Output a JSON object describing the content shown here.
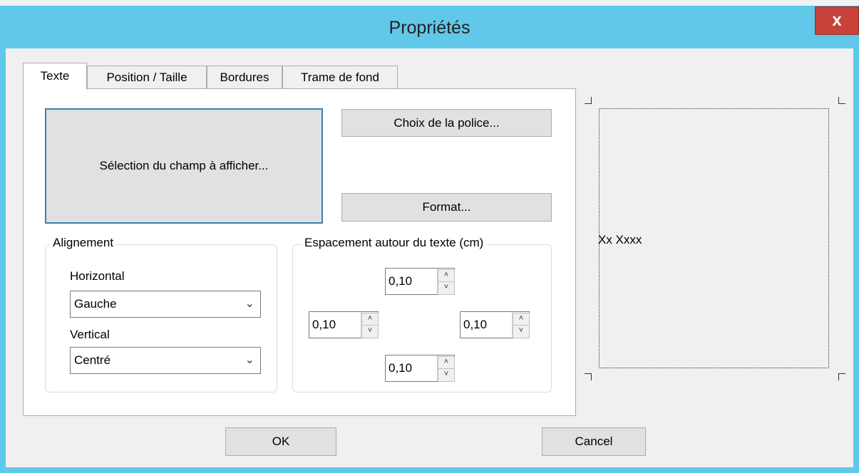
{
  "window": {
    "title": "Propriétés",
    "close_label": "x"
  },
  "tabs": [
    {
      "label": "Texte",
      "active": true
    },
    {
      "label": "Position / Taille",
      "active": false
    },
    {
      "label": "Bordures",
      "active": false
    },
    {
      "label": "Trame de fond",
      "active": false
    }
  ],
  "texte_tab": {
    "select_field_button": "Sélection du champ à afficher...",
    "font_button": "Choix de la police...",
    "format_button": "Format...",
    "alignment": {
      "legend": "Alignement",
      "horizontal_label": "Horizontal",
      "horizontal_value": "Gauche",
      "vertical_label": "Vertical",
      "vertical_value": "Centré"
    },
    "spacing": {
      "legend": "Espacement autour du texte (cm)",
      "top": "0,10",
      "left": "0,10",
      "right": "0,10",
      "bottom": "0,10"
    }
  },
  "preview": {
    "sample_text": "Xx Xxxx"
  },
  "footer": {
    "ok_label": "OK",
    "cancel_label": "Cancel"
  },
  "colors": {
    "title_bar": "#62c8ea",
    "close_button": "#c8423b",
    "focus_border": "#3c7fb1"
  }
}
